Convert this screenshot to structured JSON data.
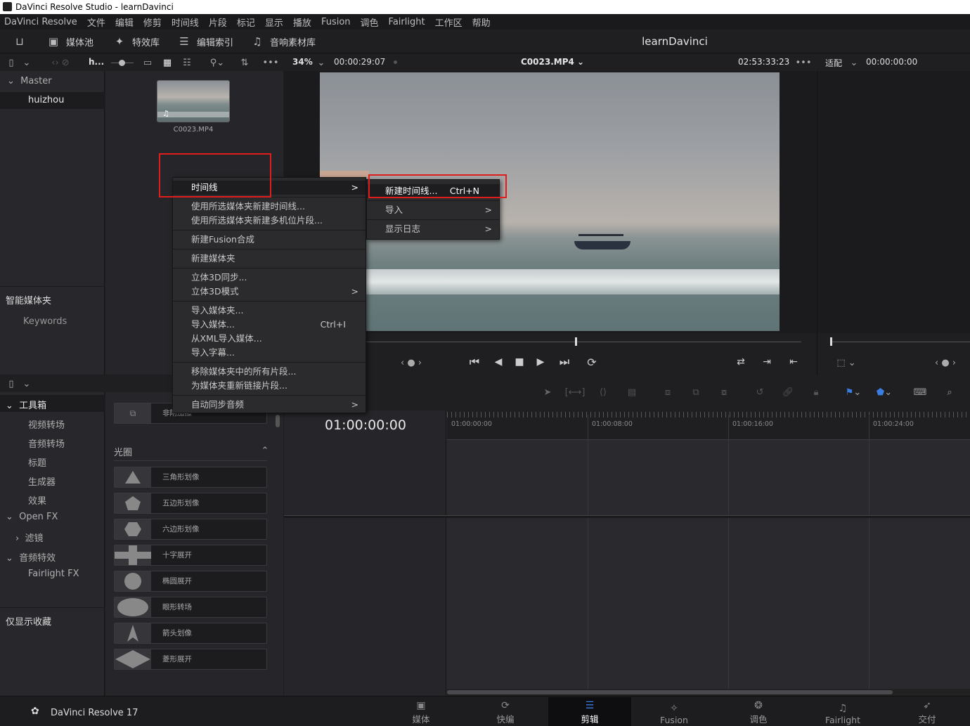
{
  "window": {
    "title": "DaVinci Resolve Studio - learnDavinci"
  },
  "menubar": [
    "DaVinci Resolve",
    "文件",
    "编辑",
    "修剪",
    "时间线",
    "片段",
    "标记",
    "显示",
    "播放",
    "Fusion",
    "调色",
    "Fairlight",
    "工作区",
    "帮助"
  ],
  "toolbar": {
    "media_pool": "媒体池",
    "effects_library": "特效库",
    "edit_index": "编辑索引",
    "sound_library": "音响素材库",
    "project_title": "learnDavinci"
  },
  "pool_bar": {
    "search_field": "h...",
    "zoom": "34%",
    "source_timecode": "00:00:29:07",
    "clip_name": "C0023.MP4",
    "timeline_timecode": "02:53:33:23",
    "fit_label": "适配",
    "right_timecode": "00:00:00:00"
  },
  "bins": {
    "master": "Master",
    "selected": "huizhou",
    "smart_bins": "智能媒体夹",
    "keywords": "Keywords"
  },
  "clip": {
    "name": "C0023.MP4"
  },
  "context_menu": {
    "items": [
      {
        "label": "时间线",
        "arrow": ">"
      },
      {
        "label": "使用所选媒体夹新建时间线..."
      },
      {
        "label": "使用所选媒体夹新建多机位片段..."
      },
      {
        "label": "新建Fusion合成"
      },
      {
        "label": "新建媒体夹"
      },
      {
        "label": "立体3D同步..."
      },
      {
        "label": "立体3D模式",
        "arrow": ">"
      },
      {
        "label": "导入媒体夹..."
      },
      {
        "label": "导入媒体...",
        "shortcut": "Ctrl+I"
      },
      {
        "label": "从XML导入媒体..."
      },
      {
        "label": "导入字幕..."
      },
      {
        "label": "移除媒体夹中的所有片段..."
      },
      {
        "label": "为媒体夹重新链接片段..."
      },
      {
        "label": "自动同步音频",
        "arrow": ">"
      }
    ]
  },
  "submenu": {
    "items": [
      {
        "label": "新建时间线...",
        "shortcut": "Ctrl+N"
      },
      {
        "label": "导入",
        "arrow": ">"
      },
      {
        "label": "显示日志",
        "arrow": ">"
      }
    ]
  },
  "toolbox": {
    "header": "工具箱",
    "items": [
      "视频转场",
      "音频转场",
      "标题",
      "生成器",
      "效果"
    ],
    "openfx": "Open FX",
    "filters": "滤镜",
    "audio_fx": "音频特效",
    "fairlight_fx": "Fairlight FX",
    "favorites": "仅显示收藏"
  },
  "effects": {
    "partial_label": "非附加擦",
    "section": "光圈",
    "items": [
      "三角形划像",
      "五边形划像",
      "六边形划像",
      "十字展开",
      "椭圆展开",
      "眼形转场",
      "箭头划像",
      "菱形展开"
    ]
  },
  "timeline": {
    "current_tc": "01:00:00:00",
    "ruler": [
      "01:00:00:00",
      "01:00:08:00",
      "01:00:16:00",
      "01:00:24:00"
    ]
  },
  "bottom": {
    "app_name": "DaVinci Resolve 17",
    "tabs": [
      "媒体",
      "快编",
      "剪辑",
      "Fusion",
      "调色",
      "Fairlight",
      "交付"
    ]
  }
}
